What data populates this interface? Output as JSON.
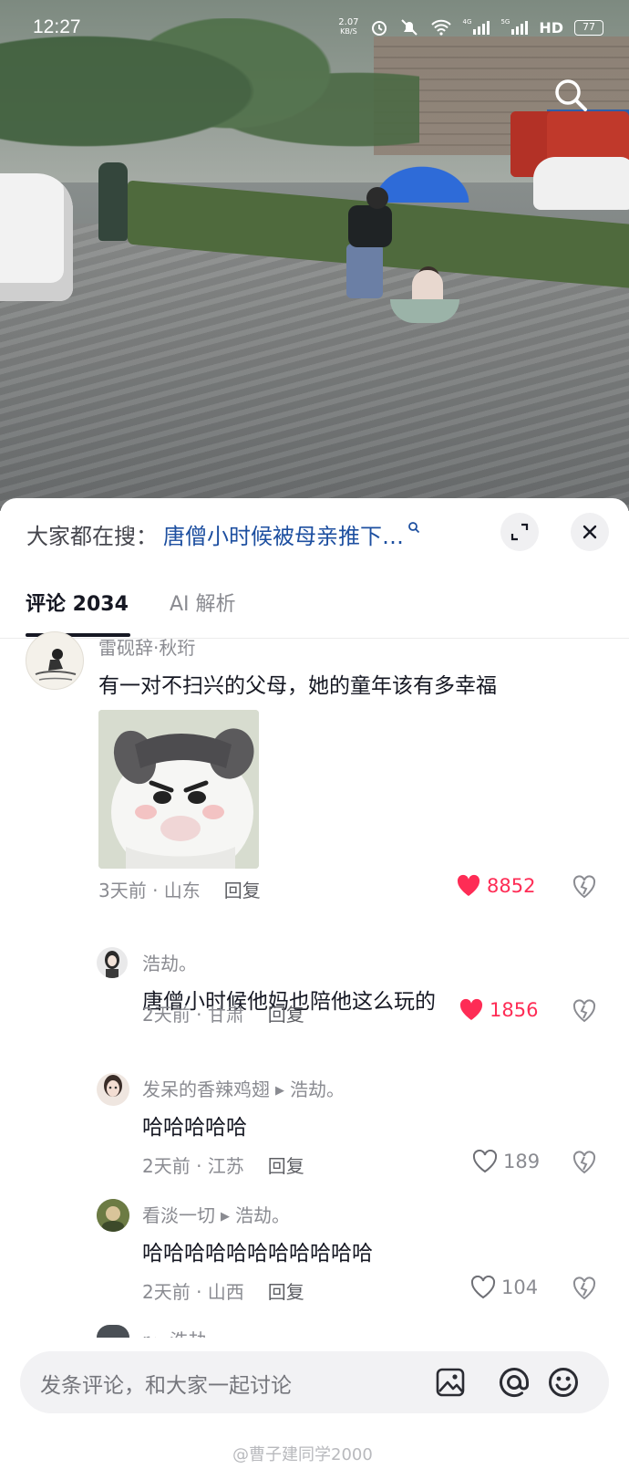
{
  "status_bar": {
    "time": "12:27",
    "net_speed_value": "2.07",
    "net_speed_unit": "KB/S",
    "signal_1_label": "4G",
    "signal_2_label": "5G",
    "hd_label": "HD",
    "battery": "77"
  },
  "video": {
    "search_icon": "search-icon"
  },
  "hot_search": {
    "lead": "大家都在搜：",
    "term": "唐僧小时候被母亲推下…",
    "expand_icon": "expand-icon",
    "close_icon": "close-icon"
  },
  "tabs": {
    "comments": "评论 2034",
    "ai": "AI 解析"
  },
  "comments": [
    {
      "user": "雷砚辞·秋珩",
      "text": "有一对不扫兴的父母，她的童年该有多幸福",
      "time_loc": "3天前 · 山东",
      "reply": "回复",
      "likes": "8852",
      "liked": true
    },
    {
      "user": "浩劫。",
      "text": "唐僧小时候他妈也陪他这么玩的",
      "time_loc": "2天前 · 甘肃",
      "reply": "回复",
      "likes": "1856",
      "liked": true
    },
    {
      "user": "发呆的香辣鸡翅",
      "reply_to": "浩劫。",
      "text": "哈哈哈哈哈",
      "time_loc": "2天前 · 江苏",
      "reply": "回复",
      "likes": "189",
      "liked": false
    },
    {
      "user": "看淡一切",
      "reply_to": "浩劫。",
      "text": "哈哈哈哈哈哈哈哈哈哈哈",
      "time_loc": "2天前 · 山西",
      "reply": "回复",
      "likes": "104",
      "liked": false
    },
    {
      "user": "r",
      "reply_to": "浩劫。"
    }
  ],
  "composer": {
    "placeholder": "发条评论，和大家一起讨论"
  },
  "watermark": "@曹子建同学2000",
  "colors": {
    "like_red": "#fe2c55",
    "link_blue": "#1d4fa0",
    "muted_gray": "#8a8b91"
  }
}
